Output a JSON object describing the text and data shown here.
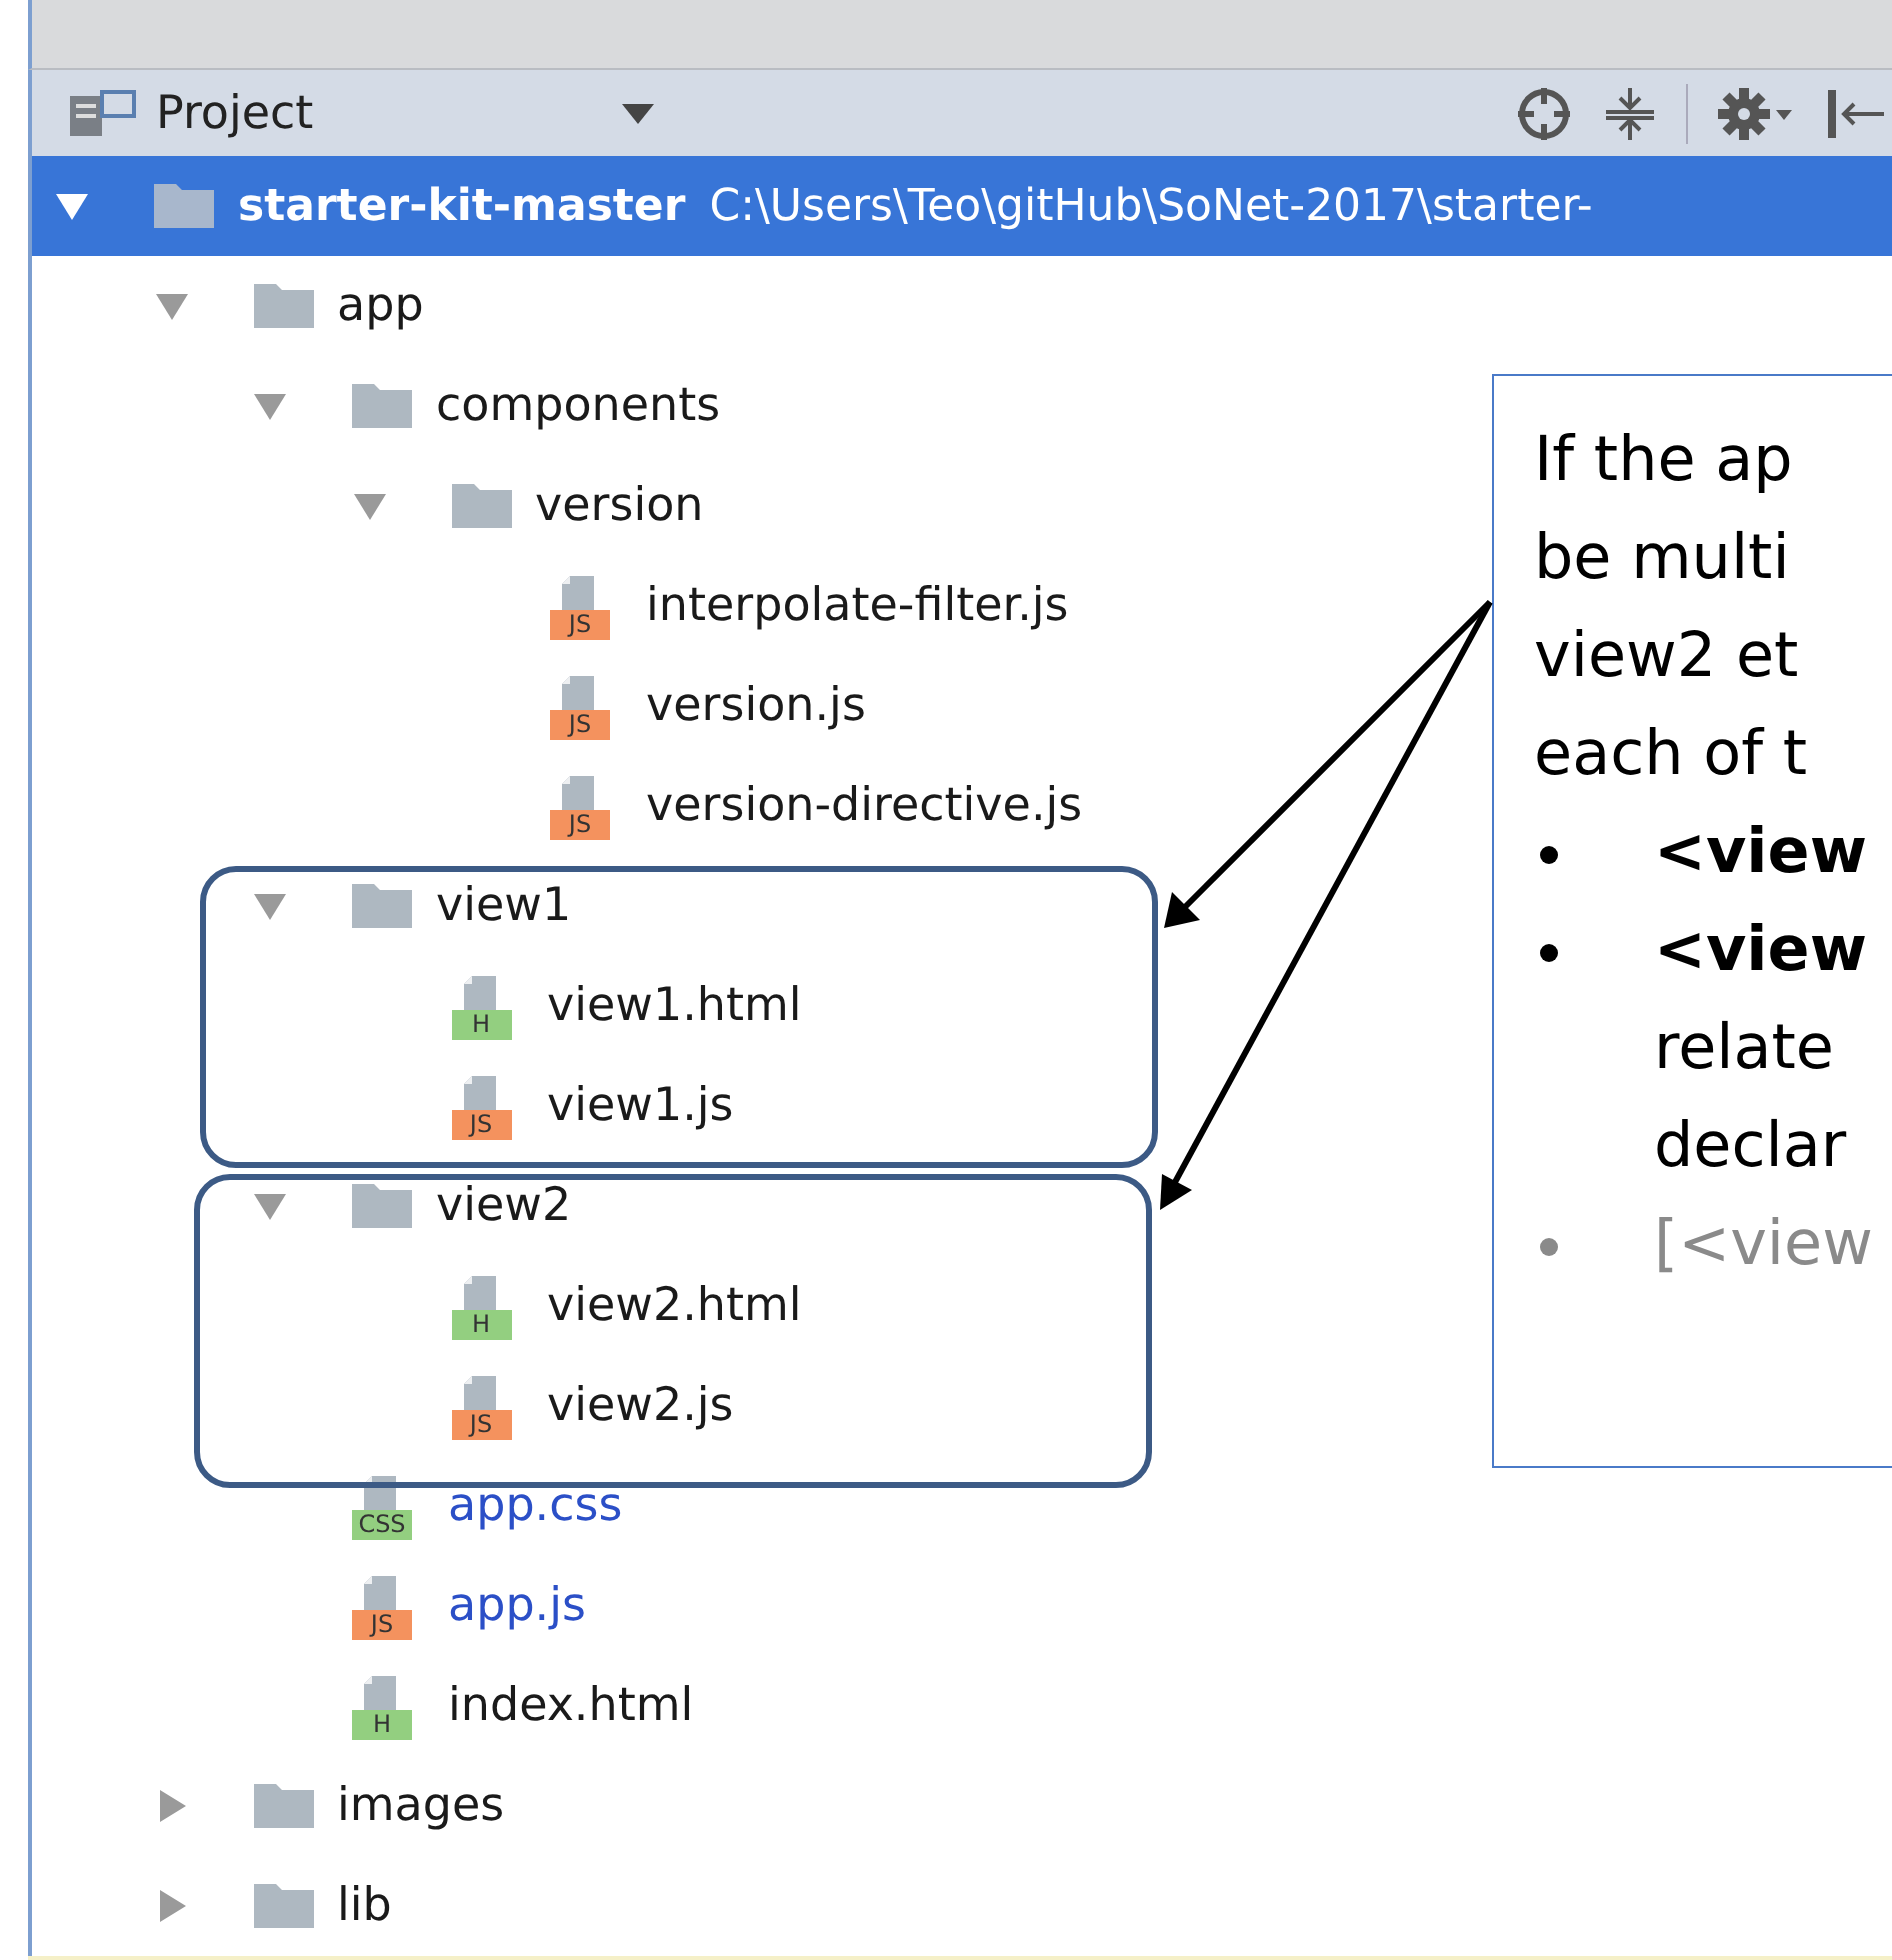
{
  "toolbar": {
    "title": "Project"
  },
  "tree": [
    {
      "name": "starter-kit-master",
      "path": "C:\\Users\\Teo\\gitHub\\SoNet-2017\\starter-",
      "kind": "folder",
      "expanded": true,
      "selected": true,
      "children": [
        {
          "name": "app",
          "kind": "folder",
          "expanded": true,
          "selected": false,
          "children": [
            {
              "name": "components",
              "kind": "folder",
              "expanded": true,
              "selected": false,
              "children": [
                {
                  "name": "version",
                  "kind": "folder",
                  "expanded": true,
                  "selected": false,
                  "children": [
                    {
                      "name": "interpolate-filter.js",
                      "kind": "file",
                      "badge": "JS",
                      "color": "#f4925e",
                      "modified": false,
                      "selected": false
                    },
                    {
                      "name": "version.js",
                      "kind": "file",
                      "badge": "JS",
                      "color": "#f4925e",
                      "modified": false,
                      "selected": false
                    },
                    {
                      "name": "version-directive.js",
                      "kind": "file",
                      "badge": "JS",
                      "color": "#f4925e",
                      "modified": false,
                      "selected": false
                    }
                  ]
                }
              ]
            },
            {
              "name": "view1",
              "kind": "folder",
              "expanded": true,
              "selected": false,
              "children": [
                {
                  "name": "view1.html",
                  "kind": "file",
                  "badge": "H",
                  "color": "#93cf80",
                  "modified": false,
                  "selected": false
                },
                {
                  "name": "view1.js",
                  "kind": "file",
                  "badge": "JS",
                  "color": "#f4925e",
                  "modified": false,
                  "selected": false
                }
              ]
            },
            {
              "name": "view2",
              "kind": "folder",
              "expanded": true,
              "selected": false,
              "children": [
                {
                  "name": "view2.html",
                  "kind": "file",
                  "badge": "H",
                  "color": "#93cf80",
                  "modified": false,
                  "selected": false
                },
                {
                  "name": "view2.js",
                  "kind": "file",
                  "badge": "JS",
                  "color": "#f4925e",
                  "modified": false,
                  "selected": false
                }
              ]
            },
            {
              "name": "app.css",
              "kind": "file",
              "badge": "CSS",
              "color": "#93cf80",
              "modified": true,
              "selected": false
            },
            {
              "name": "app.js",
              "kind": "file",
              "badge": "JS",
              "color": "#f4925e",
              "modified": true,
              "selected": false
            },
            {
              "name": "index.html",
              "kind": "file",
              "badge": "H",
              "color": "#93cf80",
              "modified": false,
              "selected": false
            }
          ]
        },
        {
          "name": "images",
          "kind": "folder",
          "expanded": false,
          "selected": false
        },
        {
          "name": "lib",
          "kind": "folder",
          "expanded": false,
          "selected": false
        }
      ]
    }
  ],
  "callout": {
    "lines": [
      "If the ap",
      "be multi",
      "view2 et",
      "each of t"
    ],
    "bullets": [
      {
        "title": "<view",
        "bold": true,
        "muted": false
      },
      {
        "title": "<view",
        "lines": [
          "relate",
          "declar"
        ],
        "bold": true,
        "muted": false
      },
      {
        "title": "[<view",
        "bold": false,
        "muted": true
      }
    ]
  }
}
